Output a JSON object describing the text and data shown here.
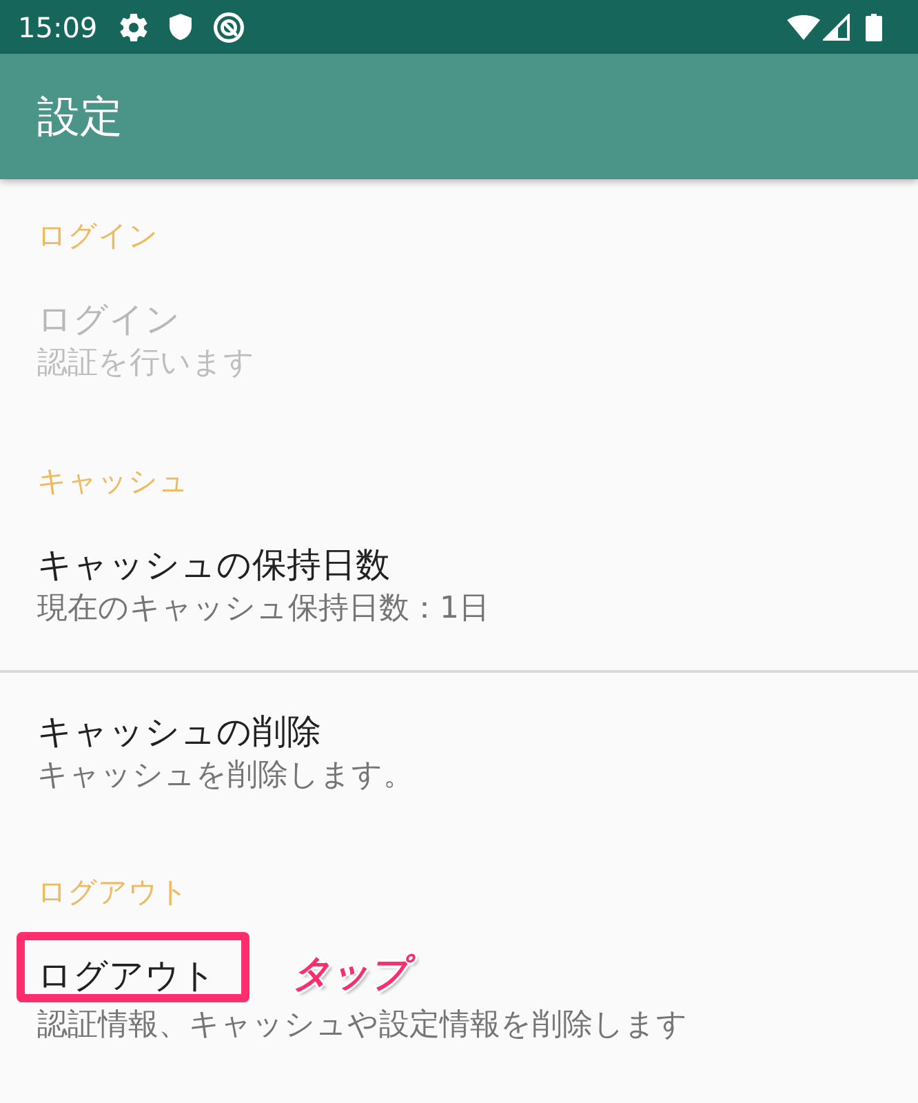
{
  "status_bar": {
    "time": "15:09"
  },
  "app_bar": {
    "title": "設定"
  },
  "categories": [
    {
      "title": "ログイン",
      "items": [
        {
          "title": "ログイン",
          "summary": "認証を行います",
          "disabled": true,
          "highlighted": false
        }
      ]
    },
    {
      "title": "キャッシュ",
      "items": [
        {
          "title": "キャッシュの保持日数",
          "summary": "現在のキャッシュ保持日数：1日",
          "disabled": false,
          "highlighted": false
        },
        {
          "title": "キャッシュの削除",
          "summary": "キャッシュを削除します。",
          "disabled": false,
          "highlighted": false
        }
      ]
    },
    {
      "title": "ログアウト",
      "items": [
        {
          "title": "ログアウト",
          "summary": "認証情報、キャッシュや設定情報を削除します",
          "disabled": false,
          "highlighted": true,
          "annotation": "タップ"
        }
      ]
    }
  ]
}
